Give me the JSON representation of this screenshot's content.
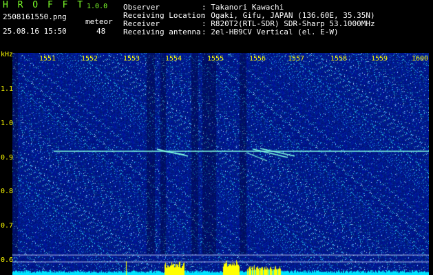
{
  "header": {
    "app_title": "H R O F F T",
    "app_version": "1.0.0",
    "file_name": "2508161550.png",
    "event_label": "meteor",
    "datetime": "25.08.16 15:50",
    "event_count": "48"
  },
  "info": {
    "observer_label": "Observer",
    "observer_value": ": Takanori Kawachi",
    "location_label": "Receiving Location",
    "location_value": ": Ogaki, Gifu, JAPAN (136.60E, 35.35N)",
    "receiver_label": "Receiver",
    "receiver_value": ": R820T2(RTL-SDR) SDR-Sharp 53.1000MHz",
    "antenna_label": "Receiving antenna",
    "antenna_value": ": 2el-HB9CV Vertical (el. E-W)"
  },
  "axes": {
    "y_unit": "kHz",
    "x_ticks": [
      "1551",
      "1552",
      "1553",
      "1554",
      "1555",
      "1556",
      "1557",
      "1558",
      "1559",
      "1600"
    ],
    "y_ticks": [
      "1.1",
      "1.0",
      "0.9",
      "0.8",
      "0.7",
      "0.6"
    ]
  },
  "colors": {
    "background": "#000000",
    "plot_bg": "#0a1a8c",
    "text_green": "#7cff2a",
    "text_white": "#ffffff",
    "text_yellow": "#ffff00",
    "signal": "#7fffe0",
    "amplitude_yellow": "#ffff00",
    "amplitude_cyan": "#00e5ff"
  }
}
